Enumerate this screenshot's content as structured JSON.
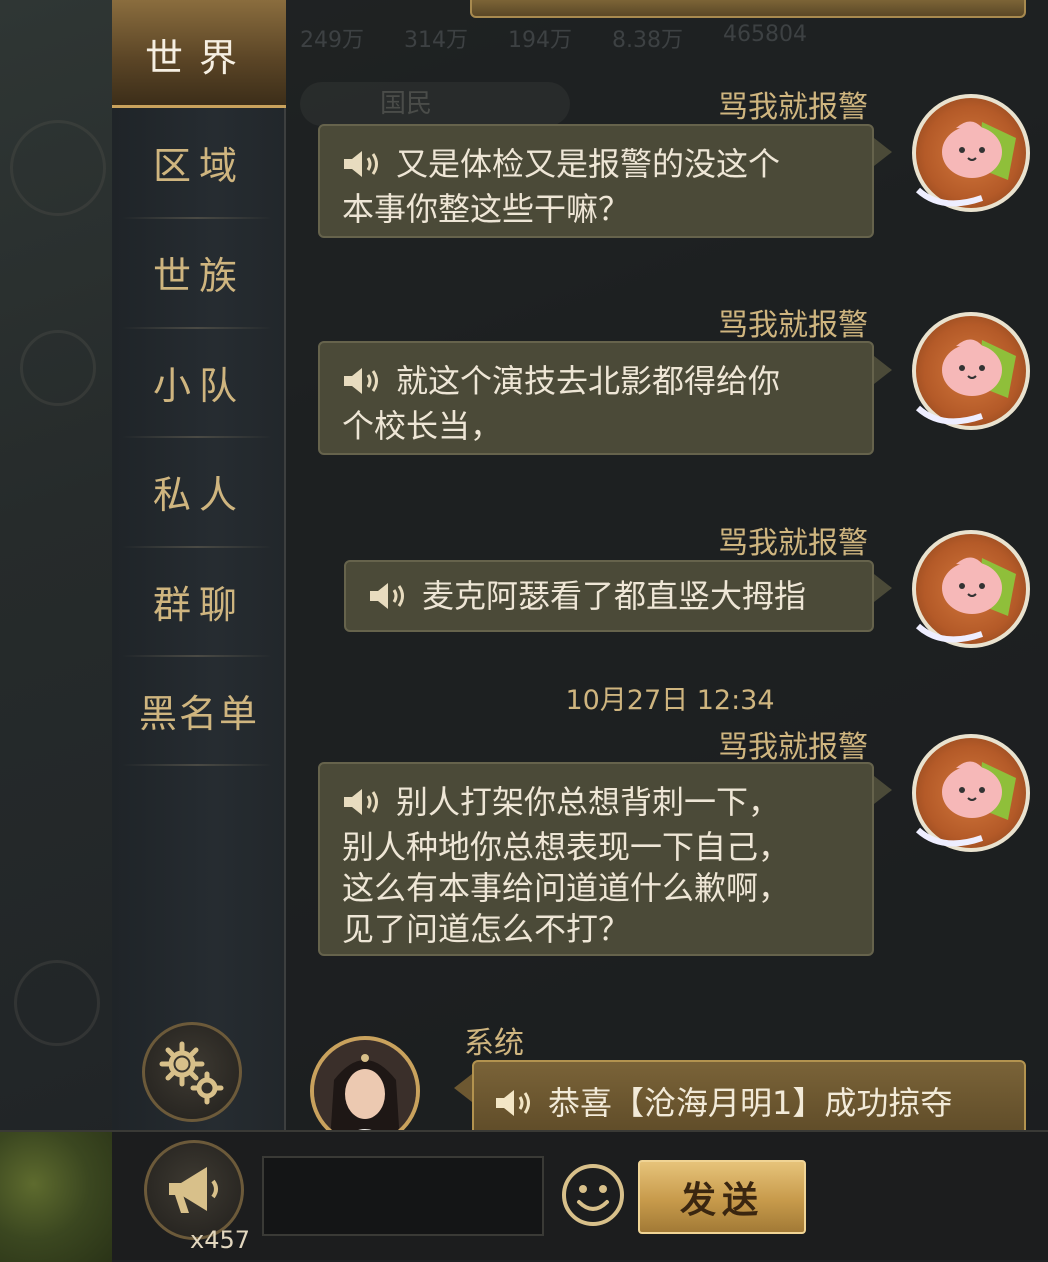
{
  "sidebar": {
    "tabs": [
      {
        "label": "世界",
        "active": true
      },
      {
        "label": "区域",
        "active": false
      },
      {
        "label": "世族",
        "active": false
      },
      {
        "label": "小队",
        "active": false
      },
      {
        "label": "私人",
        "active": false
      },
      {
        "label": "群聊",
        "active": false
      },
      {
        "label": "黑名单",
        "active": false
      }
    ],
    "settings_icon": "gear-icon"
  },
  "background": {
    "stats": [
      "249万",
      "314万",
      "194万",
      "8.38万",
      "465804"
    ],
    "pill_label": "国民"
  },
  "messages": [
    {
      "sender": "骂我就报警",
      "lines": [
        "又是体检又是报警的没这个",
        "本事你整这些干嘛？"
      ]
    },
    {
      "sender": "骂我就报警",
      "lines": [
        "就这个演技去北影都得给你",
        "个校长当，"
      ]
    },
    {
      "sender": "骂我就报警",
      "lines": [
        "麦克阿瑟看了都直竖大拇指"
      ]
    },
    {
      "sender": "骂我就报警",
      "lines": [
        "别人打架你总想背刺一下，",
        "别人种地你总想表现一下自己，",
        "这么有本事给问道道什么歉啊，",
        "见了问道怎么不打？"
      ]
    }
  ],
  "timestamp": "10月27日 12:34",
  "system_message": {
    "sender": "系统",
    "text": "恭喜【沧海月明1】成功掠夺"
  },
  "bottom_bar": {
    "horn_count": "x457",
    "input_value": "",
    "send_label": "发送"
  },
  "colors": {
    "accent_gold": "#cfb57f",
    "bubble": "#4b4a38",
    "system_bubble": "#7a6338",
    "send_button": "#c79a4b"
  }
}
